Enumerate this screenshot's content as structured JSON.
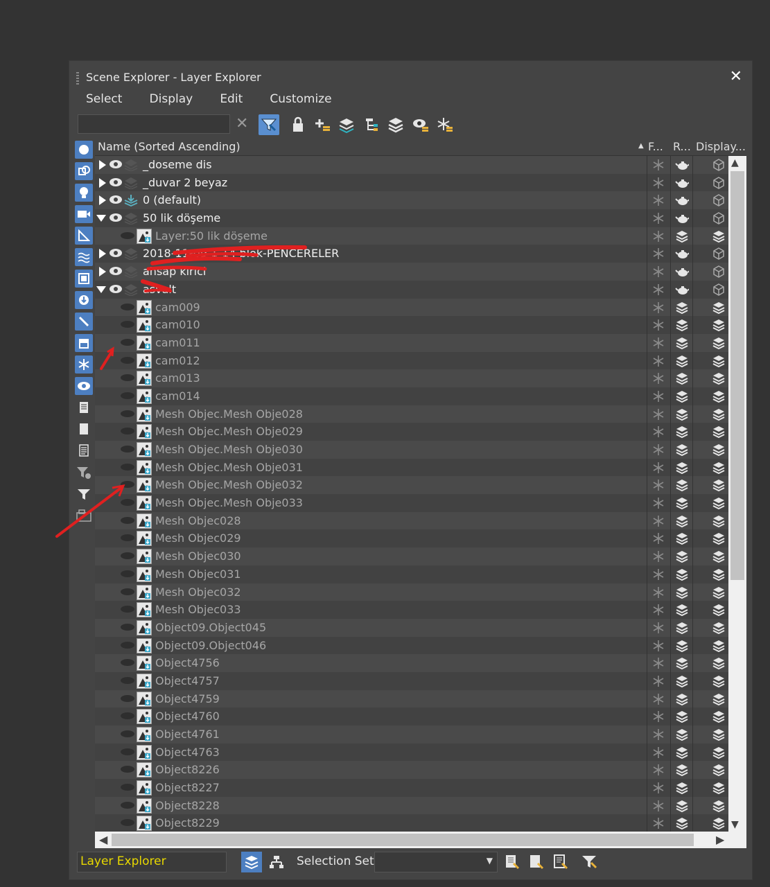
{
  "window": {
    "title": "Scene Explorer - Layer Explorer",
    "close_glyph": "✕"
  },
  "menu": [
    "Select",
    "Display",
    "Edit",
    "Customize"
  ],
  "toolbar": {
    "search_value": "",
    "clear_glyph": "✕",
    "icons": [
      "filter-select-icon",
      "lock-icon",
      "add-to-layer-icon",
      "layers-icon",
      "hierarchy-icon",
      "layer-stack-icon",
      "show-hide-icon",
      "freeze-icon"
    ]
  },
  "columns": {
    "name": "Name (Sorted Ascending)",
    "sort_glyph": "▲",
    "freeze": "F...",
    "render": "R...",
    "display": "Display..."
  },
  "rows": [
    {
      "type": "layer",
      "expanded": false,
      "name": "_doseme dis"
    },
    {
      "type": "layer",
      "expanded": false,
      "name": "_duvar 2 beyaz"
    },
    {
      "type": "layer",
      "expanded": false,
      "name": "0 (default)",
      "current": true
    },
    {
      "type": "layer",
      "expanded": true,
      "name": "50 lik döşeme"
    },
    {
      "type": "object",
      "name": "Layer:50 lik döşeme"
    },
    {
      "type": "layer",
      "expanded": false,
      "name": "2018-11-09 1-14 blok-PENCERELER"
    },
    {
      "type": "layer",
      "expanded": false,
      "name": "ahsap kirici"
    },
    {
      "type": "layer",
      "expanded": true,
      "name": "asvalt"
    },
    {
      "type": "object",
      "name": "cam009"
    },
    {
      "type": "object",
      "name": "cam010"
    },
    {
      "type": "object",
      "name": "cam011"
    },
    {
      "type": "object",
      "name": "cam012"
    },
    {
      "type": "object",
      "name": "cam013"
    },
    {
      "type": "object",
      "name": "cam014"
    },
    {
      "type": "object",
      "name": "Mesh Objec.Mesh Obje028"
    },
    {
      "type": "object",
      "name": "Mesh Objec.Mesh Obje029"
    },
    {
      "type": "object",
      "name": "Mesh Objec.Mesh Obje030"
    },
    {
      "type": "object",
      "name": "Mesh Objec.Mesh Obje031"
    },
    {
      "type": "object",
      "name": "Mesh Objec.Mesh Obje032"
    },
    {
      "type": "object",
      "name": "Mesh Objec.Mesh Obje033"
    },
    {
      "type": "object",
      "name": "Mesh Objec028"
    },
    {
      "type": "object",
      "name": "Mesh Objec029"
    },
    {
      "type": "object",
      "name": "Mesh Objec030"
    },
    {
      "type": "object",
      "name": "Mesh Objec031"
    },
    {
      "type": "object",
      "name": "Mesh Objec032"
    },
    {
      "type": "object",
      "name": "Mesh Objec033"
    },
    {
      "type": "object",
      "name": "Object09.Object045"
    },
    {
      "type": "object",
      "name": "Object09.Object046"
    },
    {
      "type": "object",
      "name": "Object4756"
    },
    {
      "type": "object",
      "name": "Object4757"
    },
    {
      "type": "object",
      "name": "Object4759"
    },
    {
      "type": "object",
      "name": "Object4760"
    },
    {
      "type": "object",
      "name": "Object4761"
    },
    {
      "type": "object",
      "name": "Object4763"
    },
    {
      "type": "object",
      "name": "Object8226"
    },
    {
      "type": "object",
      "name": "Object8227"
    },
    {
      "type": "object",
      "name": "Object8228"
    },
    {
      "type": "object",
      "name": "Object8229"
    }
  ],
  "bottom": {
    "explorer": "Layer Explorer",
    "selection_set_label": "Selection Set:",
    "selection_set_value": ""
  },
  "colors": {
    "accent": "#4d7fc1",
    "explorer_text": "#e8d800",
    "annotation": "#e02020"
  }
}
